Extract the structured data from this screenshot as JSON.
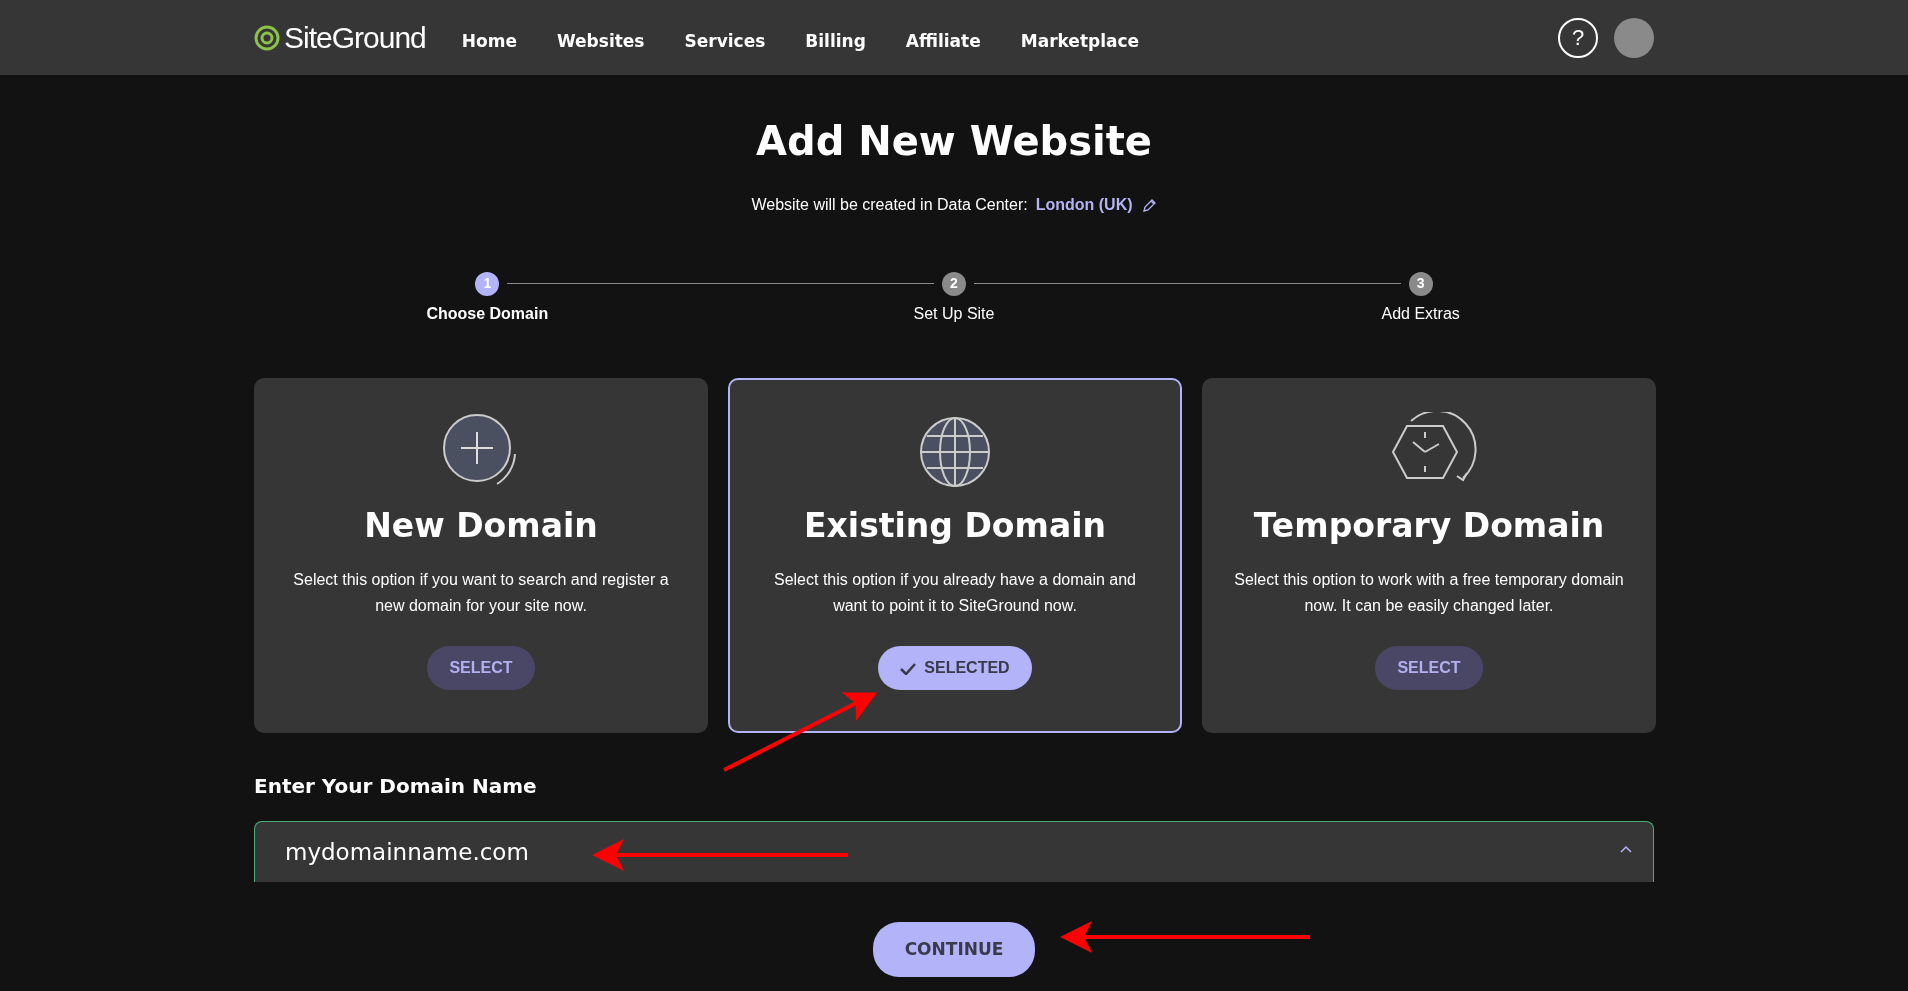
{
  "header": {
    "logo": "SiteGround",
    "nav": [
      {
        "label": "Home"
      },
      {
        "label": "Websites"
      },
      {
        "label": "Services"
      },
      {
        "label": "Billing"
      },
      {
        "label": "Affiliate"
      },
      {
        "label": "Marketplace"
      }
    ],
    "help": "?"
  },
  "page": {
    "title": "Add New Website",
    "subtitle": "Website will be created in Data Center:",
    "location": "London (UK)"
  },
  "steps": [
    {
      "number": "1",
      "label": "Choose Domain",
      "active": true
    },
    {
      "number": "2",
      "label": "Set Up Site",
      "active": false
    },
    {
      "number": "3",
      "label": "Add Extras",
      "active": false
    }
  ],
  "options": [
    {
      "kind": "new",
      "title": "New Domain",
      "description": "Select this option if you want to search and register a new domain for your site now.",
      "button": "SELECT",
      "selected": false
    },
    {
      "kind": "existing",
      "title": "Existing Domain",
      "description": "Select this option if you already have a domain and want to point it to SiteGround now.",
      "button": "SELECTED",
      "selected": true
    },
    {
      "kind": "temporary",
      "title": "Temporary Domain",
      "description": "Select this option to work with a free temporary domain now. It can be easily changed later.",
      "button": "SELECT",
      "selected": false
    }
  ],
  "domain": {
    "label": "Enter Your Domain Name",
    "value": "mydomainname.com"
  },
  "continue": "CONTINUE"
}
